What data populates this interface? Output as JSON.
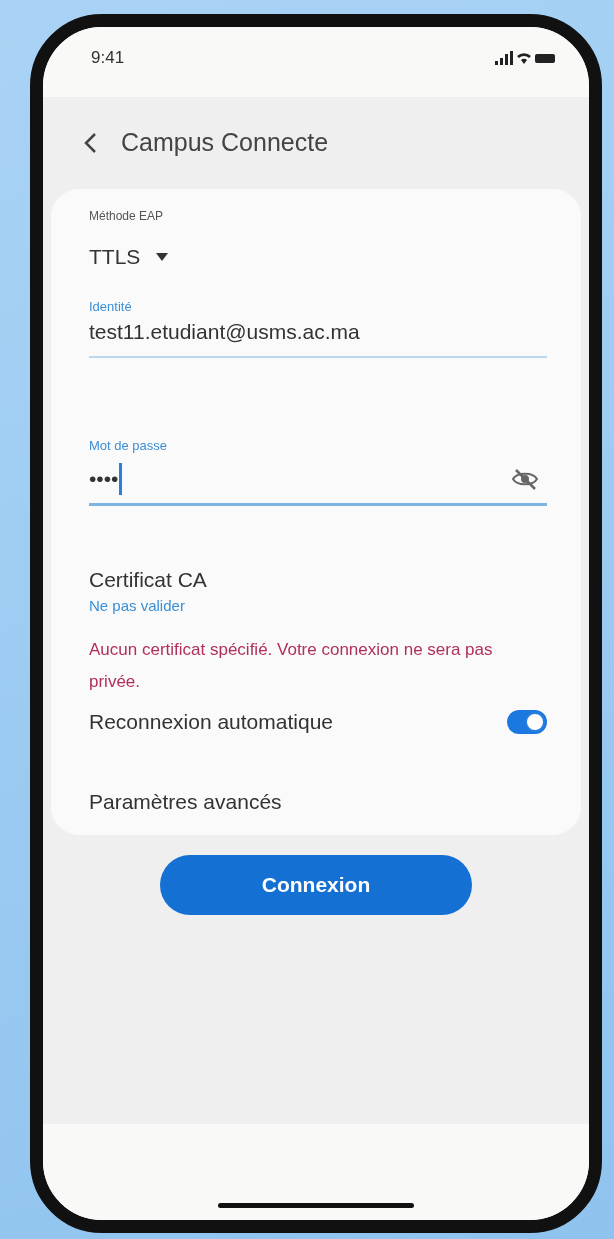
{
  "status_bar": {
    "time": "9:41"
  },
  "header": {
    "title": "Campus Connecte"
  },
  "eap_method": {
    "label": "Méthode EAP",
    "value": "TTLS"
  },
  "identity": {
    "label": "Identité",
    "value": "test11.etudiant@usms.ac.ma"
  },
  "password": {
    "label": "Mot de passe",
    "value": "••••"
  },
  "certificate": {
    "title": "Certificat CA",
    "value": "Ne pas valider",
    "warning": "Aucun certificat spécifié. Votre connexion ne sera pas privée."
  },
  "auto_reconnect": {
    "label": "Reconnexion automatique",
    "on": true
  },
  "advanced": {
    "label": "Paramètres avancés"
  },
  "connect_button": {
    "label": "Connexion"
  }
}
